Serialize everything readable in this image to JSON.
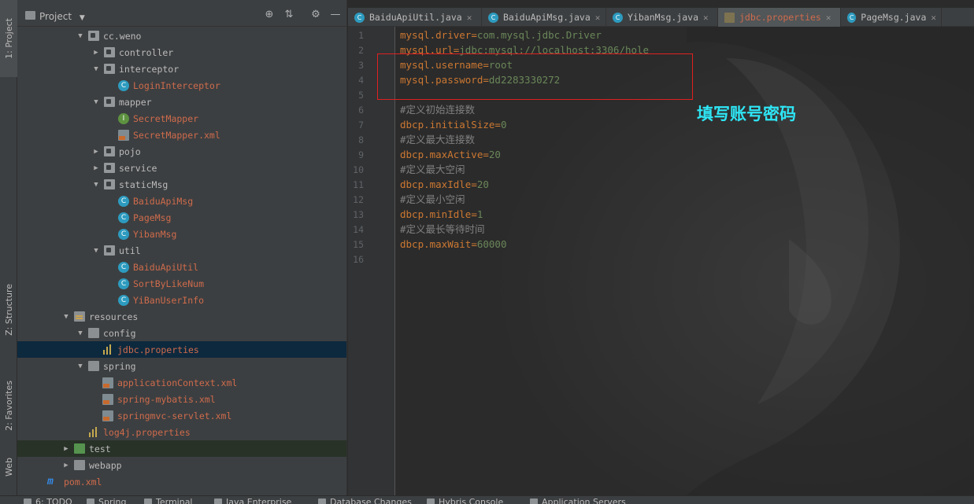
{
  "left_strip": {
    "project_label": "1: Project",
    "structure_label": "Z: Structure",
    "favorites_label": "2: Favorites",
    "web_label": "Web"
  },
  "project_panel": {
    "title": "Project",
    "tree": [
      {
        "label": "cc.weno",
        "kind": "package",
        "expanded": true,
        "color": "normal"
      },
      {
        "label": "controller",
        "kind": "package",
        "expanded": false,
        "color": "normal"
      },
      {
        "label": "interceptor",
        "kind": "package",
        "expanded": true,
        "color": "normal"
      },
      {
        "label": "LoginInterceptor",
        "kind": "class",
        "color": "red"
      },
      {
        "label": "mapper",
        "kind": "package",
        "expanded": true,
        "color": "normal"
      },
      {
        "label": "SecretMapper",
        "kind": "interface",
        "color": "red"
      },
      {
        "label": "SecretMapper.xml",
        "kind": "xml",
        "color": "red"
      },
      {
        "label": "pojo",
        "kind": "package",
        "expanded": false,
        "color": "normal"
      },
      {
        "label": "service",
        "kind": "package",
        "expanded": false,
        "color": "normal"
      },
      {
        "label": "staticMsg",
        "kind": "package",
        "expanded": true,
        "color": "normal"
      },
      {
        "label": "BaiduApiMsg",
        "kind": "class",
        "color": "red"
      },
      {
        "label": "PageMsg",
        "kind": "class",
        "color": "red"
      },
      {
        "label": "YibanMsg",
        "kind": "class",
        "color": "red"
      },
      {
        "label": "util",
        "kind": "package",
        "expanded": true,
        "color": "normal"
      },
      {
        "label": "BaiduApiUtil",
        "kind": "class",
        "color": "red"
      },
      {
        "label": "SortByLikeNum",
        "kind": "class",
        "color": "red"
      },
      {
        "label": "YiBanUserInfo",
        "kind": "class",
        "color": "red"
      },
      {
        "label": "resources",
        "kind": "resfolder",
        "expanded": true,
        "color": "normal"
      },
      {
        "label": "config",
        "kind": "folder",
        "expanded": true,
        "color": "normal"
      },
      {
        "label": "jdbc.properties",
        "kind": "properties",
        "color": "red",
        "selected": true
      },
      {
        "label": "spring",
        "kind": "folder",
        "expanded": true,
        "color": "normal"
      },
      {
        "label": "applicationContext.xml",
        "kind": "xml",
        "color": "red"
      },
      {
        "label": "spring-mybatis.xml",
        "kind": "xml",
        "color": "red"
      },
      {
        "label": "springmvc-servlet.xml",
        "kind": "xml",
        "color": "red"
      },
      {
        "label": "log4j.properties",
        "kind": "properties",
        "color": "red"
      },
      {
        "label": "test",
        "kind": "greenfolder",
        "expanded": false,
        "color": "normal"
      },
      {
        "label": "webapp",
        "kind": "folder",
        "expanded": false,
        "color": "normal"
      },
      {
        "label": "pom.xml",
        "kind": "maven",
        "color": "red"
      }
    ]
  },
  "editor": {
    "tabs": [
      {
        "label": "BaiduApiUtil.java",
        "active": false
      },
      {
        "label": "BaiduApiMsg.java",
        "active": false
      },
      {
        "label": "YibanMsg.java",
        "active": false
      },
      {
        "label": "jdbc.properties",
        "active": true
      },
      {
        "label": "PageMsg.java",
        "active": false
      }
    ],
    "lines": [
      {
        "n": "1",
        "key": "mysql.driver",
        "value": "com.mysql.jdbc.Driver"
      },
      {
        "n": "2",
        "key": "mysql.url",
        "value": "jdbc:mysql://localhost:3306/hole"
      },
      {
        "n": "3",
        "key": "mysql.username",
        "value": "root"
      },
      {
        "n": "4",
        "key": "mysql.password",
        "value": "dd2283330272"
      },
      {
        "n": "5",
        "comment": ""
      },
      {
        "n": "6",
        "comment": "#定义初始连接数"
      },
      {
        "n": "7",
        "key": "dbcp.initialSize",
        "value": "0"
      },
      {
        "n": "8",
        "comment": "#定义最大连接数"
      },
      {
        "n": "9",
        "key": "dbcp.maxActive",
        "value": "20"
      },
      {
        "n": "10",
        "comment": "#定义最大空闲"
      },
      {
        "n": "11",
        "key": "dbcp.maxIdle",
        "value": "20"
      },
      {
        "n": "12",
        "comment": "#定义最小空闲"
      },
      {
        "n": "13",
        "key": "dbcp.minIdle",
        "value": "1"
      },
      {
        "n": "14",
        "comment": "#定义最长等待时间"
      },
      {
        "n": "15",
        "key": "dbcp.maxWait",
        "value": "60000"
      },
      {
        "n": "16",
        "comment": ""
      }
    ],
    "annotation": "填写账号密码"
  },
  "bottom_bar": {
    "items": [
      "6: TODO",
      "Spring",
      "Terminal",
      "Java Enterprise",
      "Database Changes",
      "Hybris Console",
      "Application Servers"
    ]
  },
  "colors": {
    "key": "#cc7832",
    "value": "#6a8759",
    "comment": "#808080",
    "annotation": "#2ee6f5",
    "highlight_box": "#e02020",
    "modified_file": "#cf6b4c"
  }
}
